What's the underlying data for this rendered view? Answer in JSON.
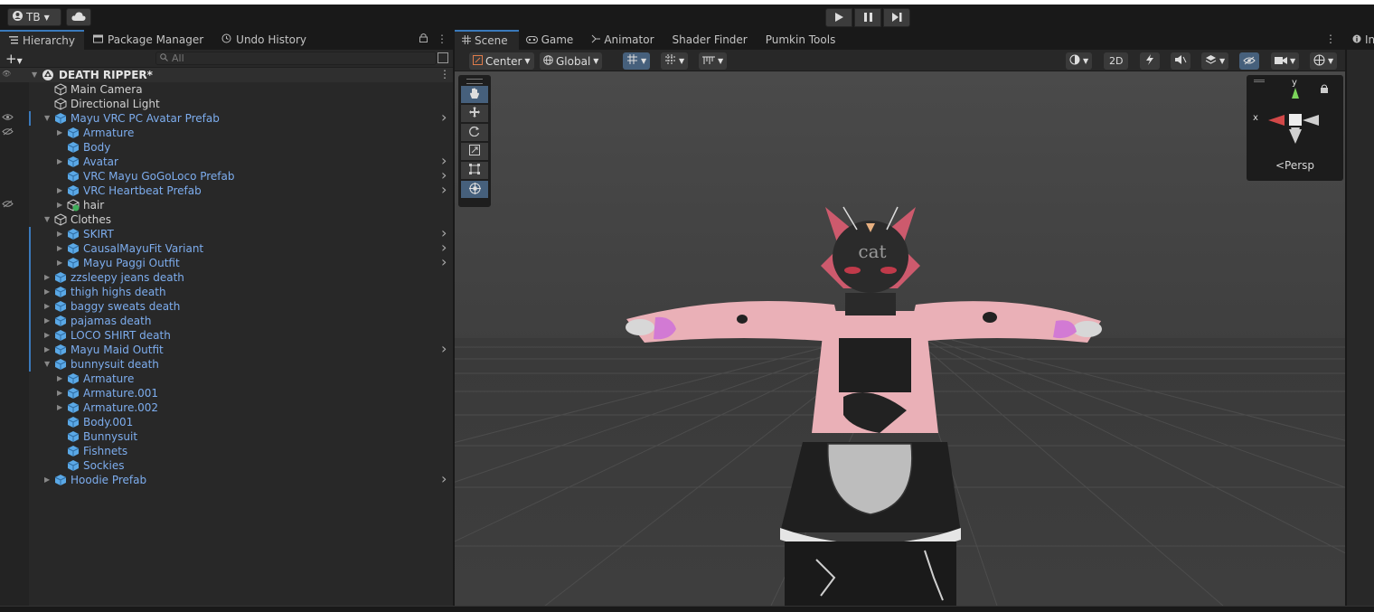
{
  "toolbar": {
    "account": "TB",
    "account_icon": "account-icon",
    "cloud_icon": "cloud-icon",
    "play_icon": "play-icon",
    "pause_icon": "pause-icon",
    "step_icon": "step-icon"
  },
  "hierarchy": {
    "tabs": [
      {
        "label": "Hierarchy",
        "icon": "list-icon"
      },
      {
        "label": "Package Manager",
        "icon": "package-icon"
      },
      {
        "label": "Undo History",
        "icon": "history-icon"
      }
    ],
    "search_placeholder": "All",
    "scene_name": "DEATH RIPPER*",
    "rows": [
      {
        "label": "Main Camera",
        "type": "object"
      },
      {
        "label": "Directional Light",
        "type": "object"
      },
      {
        "label": "Mayu VRC PC Avatar Prefab",
        "type": "prefab"
      },
      {
        "label": "Armature",
        "type": "prefab"
      },
      {
        "label": "Body",
        "type": "prefab"
      },
      {
        "label": "Avatar",
        "type": "prefab"
      },
      {
        "label": "VRC Mayu GoGoLoco Prefab",
        "type": "prefab"
      },
      {
        "label": "VRC Heartbeat Prefab",
        "type": "prefab"
      },
      {
        "label": "hair",
        "type": "object"
      },
      {
        "label": "Clothes",
        "type": "object"
      },
      {
        "label": "SKIRT",
        "type": "prefab"
      },
      {
        "label": "CausalMayuFit Variant",
        "type": "prefab"
      },
      {
        "label": "Mayu Paggi Outfit",
        "type": "prefab"
      },
      {
        "label": "zzsleepy jeans death",
        "type": "prefab"
      },
      {
        "label": "thigh highs death",
        "type": "prefab"
      },
      {
        "label": "baggy sweats death",
        "type": "prefab"
      },
      {
        "label": "pajamas death",
        "type": "prefab"
      },
      {
        "label": "LOCO SHIRT death",
        "type": "prefab"
      },
      {
        "label": "Mayu Maid Outfit",
        "type": "prefab"
      },
      {
        "label": "bunnysuit death",
        "type": "prefab"
      },
      {
        "label": "Armature",
        "type": "prefab"
      },
      {
        "label": "Armature.001",
        "type": "prefab"
      },
      {
        "label": "Armature.002",
        "type": "prefab"
      },
      {
        "label": "Body.001",
        "type": "prefab"
      },
      {
        "label": "Bunnysuit",
        "type": "prefab"
      },
      {
        "label": "Fishnets",
        "type": "prefab"
      },
      {
        "label": "Sockies",
        "type": "prefab"
      },
      {
        "label": "Hoodie Prefab",
        "type": "prefab"
      }
    ]
  },
  "scene": {
    "tabs": [
      {
        "label": "Scene",
        "icon": "grid-icon"
      },
      {
        "label": "Game",
        "icon": "gamepad-icon"
      },
      {
        "label": "Animator",
        "icon": "animator-icon"
      },
      {
        "label": "Shader Finder",
        "icon": ""
      },
      {
        "label": "Pumkin Tools",
        "icon": ""
      }
    ],
    "pivot": "Center",
    "space": "Global",
    "mode_2d": "2D",
    "persp_label": "Persp",
    "axis_x": "x",
    "axis_y": "y",
    "model_text": "cat"
  },
  "inspector": {
    "tab_label": "In"
  },
  "colors": {
    "accent": "#3a79bb",
    "prefab_text": "#7dadee",
    "prefab_icon": "#5aa8e6"
  }
}
